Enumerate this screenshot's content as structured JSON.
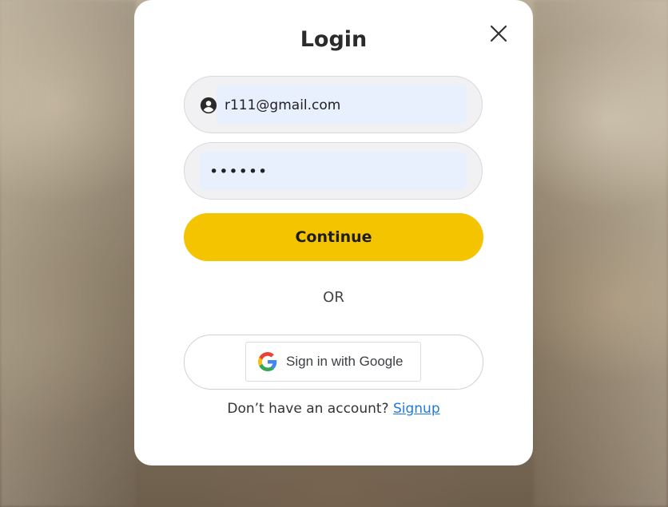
{
  "modal": {
    "title": "Login",
    "close_icon": "close-icon"
  },
  "form": {
    "email_value": "r111@gmail.com",
    "email_icon": "user-icon",
    "password_value": "••••••",
    "continue_label": "Continue",
    "or_label": "OR",
    "google_label": "Sign in with Google",
    "google_icon": "google-g-icon"
  },
  "footer": {
    "prompt": "Don’t have an account?",
    "signup_label": "Signup"
  },
  "colors": {
    "accent": "#f5c400",
    "link": "#1f7ae0",
    "field_bg": "#e8f0fe"
  }
}
